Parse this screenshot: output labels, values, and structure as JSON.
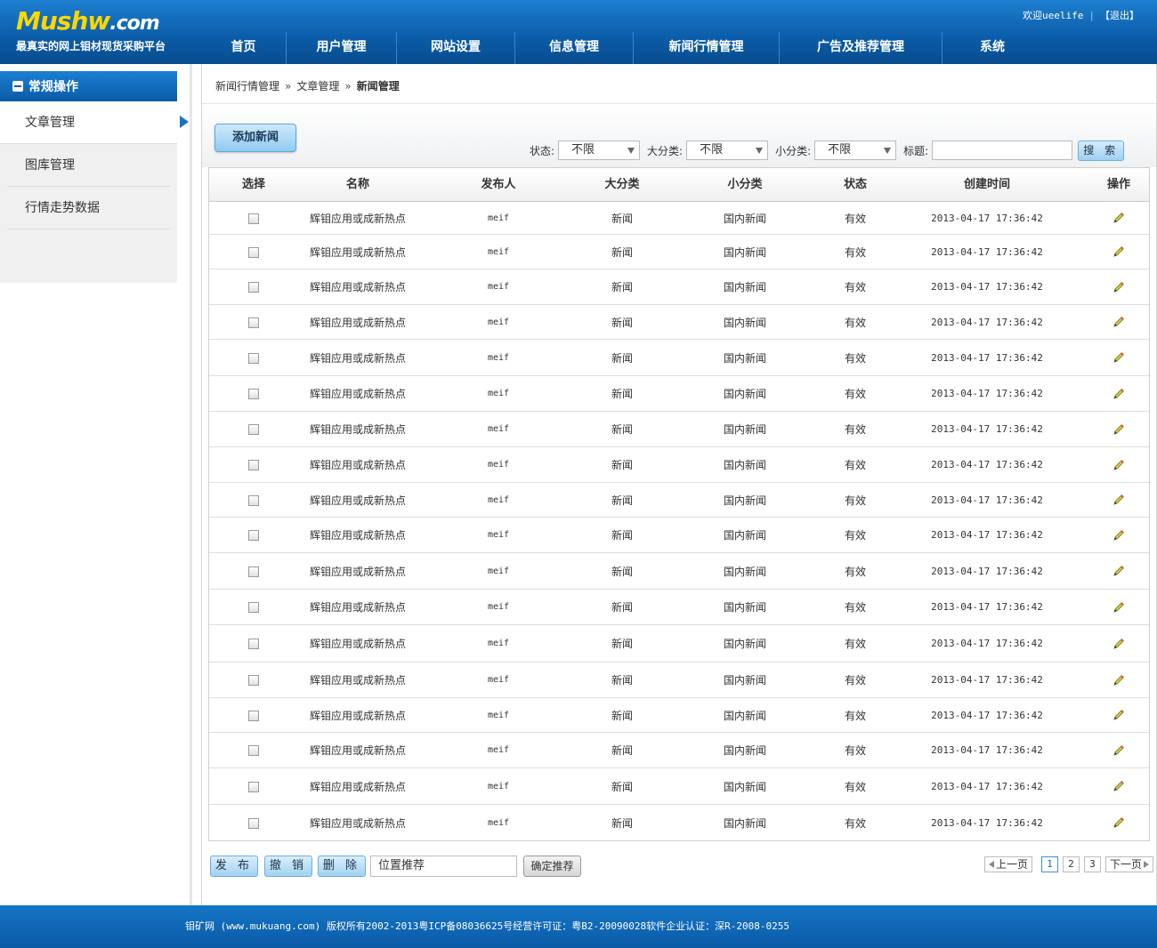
{
  "header": {
    "logo_main": "Mushw",
    "logo_suffix": ".com",
    "slogan": "最真实的网上钼材现货采购平台",
    "welcome": "欢迎ueelife",
    "separator": "|",
    "logout": "【退出】",
    "nav": [
      "首页",
      "用户管理",
      "网站设置",
      "信息管理",
      "新闻行情管理",
      "广告及推荐管理",
      "系统"
    ]
  },
  "sidebar": {
    "title": "常规操作",
    "items": [
      "文章管理",
      "图库管理",
      "行情走势数据"
    ]
  },
  "breadcrumb": {
    "level1": "新闻行情管理",
    "sep": "»",
    "level2": "文章管理",
    "current": "新闻管理"
  },
  "toolbar": {
    "add_label": "添加新闻",
    "status_label": "状态:",
    "status_value": "不限",
    "category_label": "大分类:",
    "category_value": "不限",
    "subcategory_label": "小分类:",
    "subcategory_value": "不限",
    "title_label": "标题:",
    "title_value": "",
    "search_label": "搜 索"
  },
  "table": {
    "headers": [
      "选择",
      "名称",
      "发布人",
      "大分类",
      "小分类",
      "状态",
      "创建时间",
      "操作"
    ],
    "rows": [
      {
        "name": "辉钼应用或成新热点",
        "author": "meif",
        "category": "新闻",
        "subcategory": "国内新闻",
        "status": "有效",
        "created": "2013-04-17 17:36:42"
      },
      {
        "name": "辉钼应用或成新热点",
        "author": "meif",
        "category": "新闻",
        "subcategory": "国内新闻",
        "status": "有效",
        "created": "2013-04-17 17:36:42"
      },
      {
        "name": "辉钼应用或成新热点",
        "author": "meif",
        "category": "新闻",
        "subcategory": "国内新闻",
        "status": "有效",
        "created": "2013-04-17 17:36:42"
      },
      {
        "name": "辉钼应用或成新热点",
        "author": "meif",
        "category": "新闻",
        "subcategory": "国内新闻",
        "status": "有效",
        "created": "2013-04-17 17:36:42"
      },
      {
        "name": "辉钼应用或成新热点",
        "author": "meif",
        "category": "新闻",
        "subcategory": "国内新闻",
        "status": "有效",
        "created": "2013-04-17 17:36:42"
      },
      {
        "name": "辉钼应用或成新热点",
        "author": "meif",
        "category": "新闻",
        "subcategory": "国内新闻",
        "status": "有效",
        "created": "2013-04-17 17:36:42"
      },
      {
        "name": "辉钼应用或成新热点",
        "author": "meif",
        "category": "新闻",
        "subcategory": "国内新闻",
        "status": "有效",
        "created": "2013-04-17 17:36:42"
      },
      {
        "name": "辉钼应用或成新热点",
        "author": "meif",
        "category": "新闻",
        "subcategory": "国内新闻",
        "status": "有效",
        "created": "2013-04-17 17:36:42"
      },
      {
        "name": "辉钼应用或成新热点",
        "author": "meif",
        "category": "新闻",
        "subcategory": "国内新闻",
        "status": "有效",
        "created": "2013-04-17 17:36:42"
      },
      {
        "name": "辉钼应用或成新热点",
        "author": "meif",
        "category": "新闻",
        "subcategory": "国内新闻",
        "status": "有效",
        "created": "2013-04-17 17:36:42"
      },
      {
        "name": "辉钼应用或成新热点",
        "author": "meif",
        "category": "新闻",
        "subcategory": "国内新闻",
        "status": "有效",
        "created": "2013-04-17 17:36:42"
      },
      {
        "name": "辉钼应用或成新热点",
        "author": "meif",
        "category": "新闻",
        "subcategory": "国内新闻",
        "status": "有效",
        "created": "2013-04-17 17:36:42"
      },
      {
        "name": "辉钼应用或成新热点",
        "author": "meif",
        "category": "新闻",
        "subcategory": "国内新闻",
        "status": "有效",
        "created": "2013-04-17 17:36:42"
      },
      {
        "name": "辉钼应用或成新热点",
        "author": "meif",
        "category": "新闻",
        "subcategory": "国内新闻",
        "status": "有效",
        "created": "2013-04-17 17:36:42"
      },
      {
        "name": "辉钼应用或成新热点",
        "author": "meif",
        "category": "新闻",
        "subcategory": "国内新闻",
        "status": "有效",
        "created": "2013-04-17 17:36:42"
      },
      {
        "name": "辉钼应用或成新热点",
        "author": "meif",
        "category": "新闻",
        "subcategory": "国内新闻",
        "status": "有效",
        "created": "2013-04-17 17:36:42"
      },
      {
        "name": "辉钼应用或成新热点",
        "author": "meif",
        "category": "新闻",
        "subcategory": "国内新闻",
        "status": "有效",
        "created": "2013-04-17 17:36:42"
      },
      {
        "name": "辉钼应用或成新热点",
        "author": "meif",
        "category": "新闻",
        "subcategory": "国内新闻",
        "status": "有效",
        "created": "2013-04-17 17:36:42"
      }
    ]
  },
  "actions": {
    "publish": "发 布",
    "revoke": "撤 销",
    "delete": "删 除",
    "position_value": "位置推荐",
    "confirm": "确定推荐"
  },
  "pager": {
    "prev": "上一页",
    "pages": [
      "1",
      "2",
      "3"
    ],
    "current": "1",
    "next": "下一页"
  },
  "footer": {
    "text": "钼矿网 (www.mukuang.com) 版权所有2002-2013粤ICP备08036625号经营许可证：粤B2-20090028软件企业认证：深R-2008-0255"
  },
  "colors": {
    "header_blue": "#0b5ca8",
    "accent_blue": "#1a72c2",
    "logo_yellow": "#ffd700",
    "button_blue": "#a2d2f3"
  }
}
